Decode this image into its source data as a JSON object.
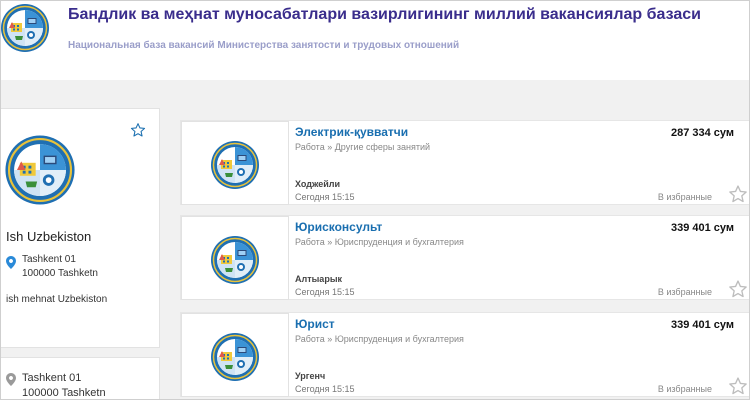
{
  "header": {
    "title": "Бандлик ва меҳнат муносабатлари вазирлигининг миллий вакансиялар базаси",
    "subtitle": "Национальная база вакансий Министерства занятости и трудовых отношений",
    "logo_icon": "ministry-emblem-icon"
  },
  "company": {
    "name": "Ish Uzbekiston",
    "address_line1": "Tashkent 01",
    "address_line2": "100000 Tashketn",
    "description": "ish mehnat Uzbekiston",
    "favorite_icon": "star-outline-icon"
  },
  "location_card": {
    "address_line1": "Tashkent 01",
    "address_line2": "100000 Tashketn"
  },
  "listings": [
    {
      "title": "Электрик-қувватчи",
      "category": "Работа » Другие сферы занятий",
      "salary": "287 334 сум",
      "city": "Ходжейли",
      "date": "Сегодня 15:15",
      "favorite_label": "В избранные"
    },
    {
      "title": "Юрисконсульт",
      "category": "Работа » Юриспруденция и бухгалтерия",
      "salary": "339 401 сум",
      "city": "Алтыарык",
      "date": "Сегодня 15:15",
      "favorite_label": "В избранные"
    },
    {
      "title": "Юрист",
      "category": "Работа » Юриспруденция и бухгалтерия",
      "salary": "339 401 сум",
      "city": "Ургенч",
      "date": "Сегодня 15:15",
      "favorite_label": "В избранные"
    }
  ],
  "colors": {
    "title": "#3a2d8c",
    "subtitle": "#9a9ec9",
    "link": "#1a6fb0",
    "favorite_star_active": "#1a6fb0",
    "favorite_star_inactive": "#bdbdbd",
    "pin_blue": "#2a8ad8",
    "pin_gray": "#9a9a9a"
  }
}
